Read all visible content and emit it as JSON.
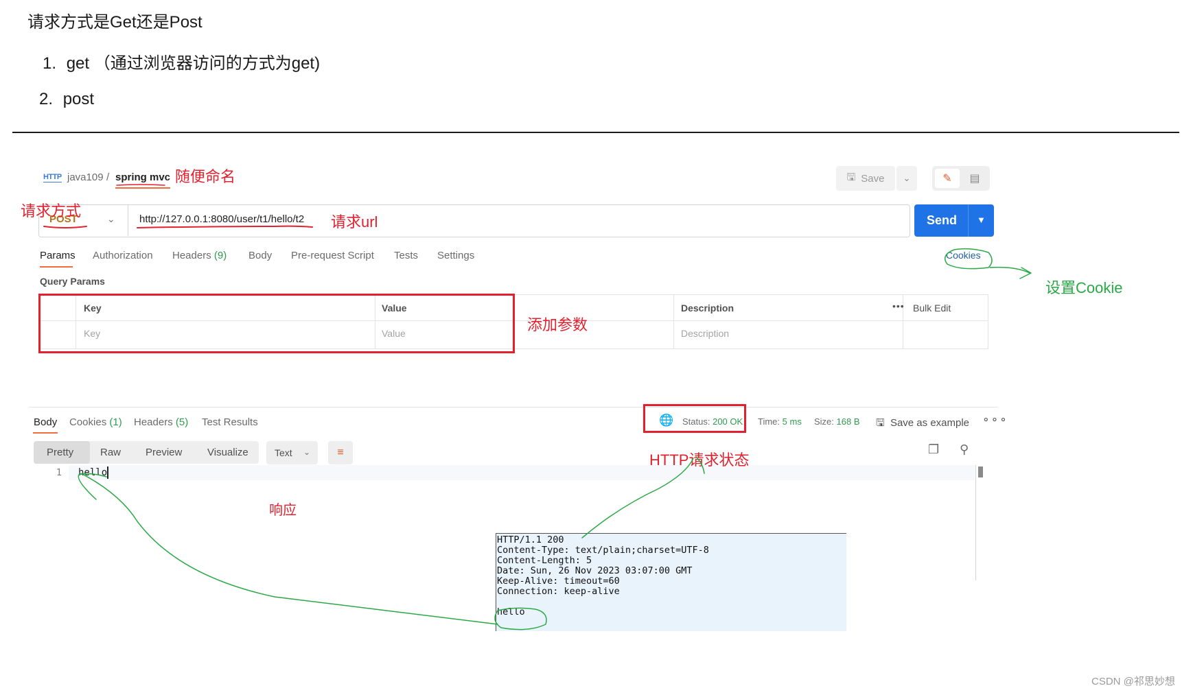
{
  "doc": {
    "title": "请求方式是Get还是Post",
    "item1_num": "1.",
    "item1_text": "get （通过浏览器访问的方式为get)",
    "item2_num": "2.",
    "item2_text": "post"
  },
  "header": {
    "http_icon_label": "HTTP",
    "collection": "java109",
    "separator": "/",
    "request_name": "spring mvc",
    "save_label": "Save"
  },
  "request": {
    "method": "POST",
    "url": "http://127.0.0.1:8080/user/t1/hello/t2",
    "send_label": "Send"
  },
  "request_tabs": [
    {
      "label": "Params"
    },
    {
      "label": "Authorization"
    },
    {
      "label": "Headers",
      "count": "(9)"
    },
    {
      "label": "Body"
    },
    {
      "label": "Pre-request Script"
    },
    {
      "label": "Tests"
    },
    {
      "label": "Settings"
    }
  ],
  "cookies_link": "Cookies",
  "query_params": {
    "title": "Query Params",
    "columns": {
      "key": "Key",
      "value": "Value",
      "description": "Description",
      "bulk_edit": "Bulk Edit"
    },
    "placeholders": {
      "key": "Key",
      "value": "Value",
      "description": "Description"
    }
  },
  "response": {
    "tabs": [
      {
        "label": "Body"
      },
      {
        "label": "Cookies",
        "count": "(1)"
      },
      {
        "label": "Headers",
        "count": "(5)"
      },
      {
        "label": "Test Results"
      }
    ],
    "status_label": "Status:",
    "status_value": "200 OK",
    "time_label": "Time:",
    "time_value": "5 ms",
    "size_label": "Size:",
    "size_value": "168 B",
    "save_example": "Save as example",
    "format_tabs": [
      "Pretty",
      "Raw",
      "Preview",
      "Visualize"
    ],
    "text_select": "Text",
    "line_number": "1",
    "body": "hello"
  },
  "raw_http": {
    "headers": "HTTP/1.1 200\nContent-Type: text/plain;charset=UTF-8\nContent-Length: 5\nDate: Sun, 26 Nov 2023 03:07:00 GMT\nKeep-Alive: timeout=60\nConnection: keep-alive",
    "body": "hello"
  },
  "annotations": {
    "name_note": "随便命名",
    "method_note": "请求方式",
    "url_note": "请求url",
    "cookie_note": "设置Cookie",
    "params_note": "添加参数",
    "status_note": "HTTP请求状态",
    "response_note": "响应"
  },
  "watermark": "CSDN @祁思妙想",
  "colors": {
    "send": "#1f73e6",
    "method": "#b5741a",
    "accent": "#f26b3a",
    "annotation_red": "#e3212e",
    "annotation_green": "#2aa845"
  }
}
